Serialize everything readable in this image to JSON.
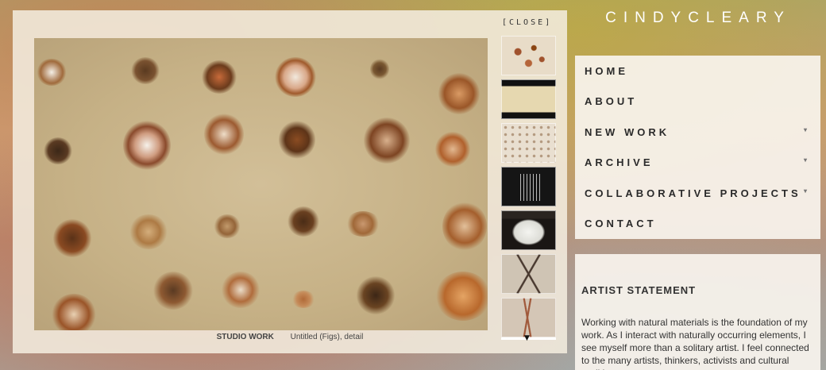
{
  "site": {
    "brand": "CINDYCLEARY"
  },
  "lightbox": {
    "close_label": "[CLOSE]",
    "caption_section": "STUDIO WORK",
    "caption_title": "Untitled (Figs), detail",
    "thumbnails": [
      {
        "name": "thumb-figs-spots"
      },
      {
        "name": "thumb-scroll-paper"
      },
      {
        "name": "thumb-dotted-paper"
      },
      {
        "name": "thumb-wire-cage"
      },
      {
        "name": "thumb-white-mass"
      },
      {
        "name": "thumb-dried-branches"
      },
      {
        "name": "thumb-roots"
      }
    ],
    "scroll_icon": "down-triangle-icon"
  },
  "nav": {
    "items": [
      {
        "label": "HOME",
        "has_submenu": false
      },
      {
        "label": "ABOUT",
        "has_submenu": false
      },
      {
        "label": "NEW WORK",
        "has_submenu": true
      },
      {
        "label": "ARCHIVE",
        "has_submenu": true
      },
      {
        "label": "COLLABORATIVE PROJECTS",
        "has_submenu": true
      },
      {
        "label": "CONTACT",
        "has_submenu": false
      }
    ],
    "submenu_icon": "chevron-down-icon"
  },
  "statement": {
    "heading": "ARTIST STATEMENT",
    "body": "Working with natural materials is the foundation of my work. As I interact with naturally occurring elements, I see myself more than a solitary artist. I feel connected to the many artists, thinkers, activists and cultural traditions – past"
  }
}
